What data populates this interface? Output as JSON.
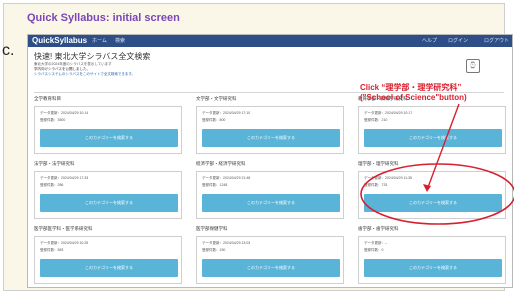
{
  "outer": {
    "title": "Quick Syllabus: initial screen",
    "side_letter": "c."
  },
  "app": {
    "brand": "QuickSyllabus",
    "nav": {
      "home": "ホーム",
      "search": "検索",
      "help": "ヘルプ",
      "login": "ログイン",
      "logout": "ログアウト"
    },
    "page_title": "快速! 東北大学シラバス全文検索",
    "notice": {
      "line1": "東北大学の2024年度のシラバスを表示しています",
      "line2": "学内向けシラバスを公開しました。",
      "line3": "シラバスシステムのシラバスをこのサイトで全文検索できます。"
    },
    "cards": [
      {
        "label": "全学教育科目",
        "updated": "データ更新：2024/04/29 10:14",
        "count": "登録件数：3500",
        "button": "このカテゴリーを検索する"
      },
      {
        "label": "文学部・文学研究科",
        "updated": "データ更新：2024/04/29 17:10",
        "count": "登録件数：800",
        "button": "このカテゴリーを検索する"
      },
      {
        "label": "教育学部・教育学研究科",
        "updated": "データ更新：2024/04/29 10:17",
        "count": "登録件数：210",
        "button": "このカテゴリーを検索する"
      },
      {
        "label": "法学部・法学研究科",
        "updated": "データ更新：2024/04/29 17:33",
        "count": "登録件数：286",
        "button": "このカテゴリーを検索する"
      },
      {
        "label": "経済学部・経済学研究科",
        "updated": "データ更新：2024/04/29 21:48",
        "count": "登録件数：1248",
        "button": "このカテゴリーを検索する"
      },
      {
        "label": "理学部・理学研究科",
        "updated": "データ更新：2024/04/29 11:35",
        "count": "登録件数：733",
        "button": "このカテゴリーを検索する"
      },
      {
        "label": "医学部医学科・医学系研究科",
        "updated": "データ更新：2024/04/29 10:25",
        "count": "登録件数：583",
        "button": "このカテゴリーを検索する"
      },
      {
        "label": "医学部保健学科",
        "updated": "データ更新：2024/04/29 13:03",
        "count": "登録件数：150",
        "button": "このカテゴリーを検索する"
      },
      {
        "label": "歯学部・歯学研究科",
        "updated": "データ更新：--",
        "count": "登録件数：0",
        "button": "このカテゴリーを検索する"
      }
    ]
  },
  "annotation": {
    "line1": "Click “理学部・理学研究科”",
    "line2": "(\"School of Science\"button)",
    "color": "#d81f2e"
  }
}
